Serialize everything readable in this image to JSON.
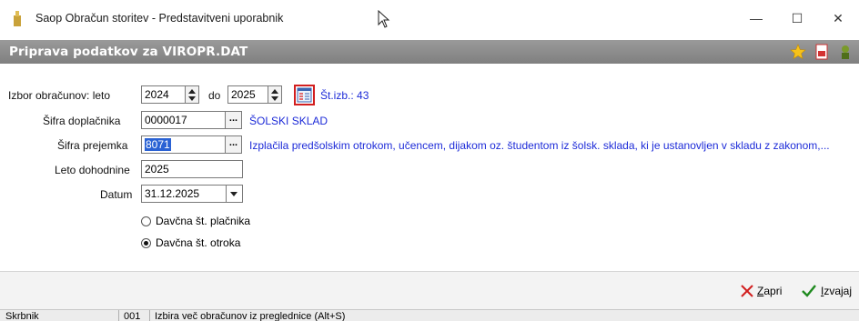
{
  "window": {
    "title": "Saop Obračun storitev - Predstavitveni uporabnik",
    "minimize_label": "—",
    "maximize_label": "☐",
    "close_label": "✕"
  },
  "header": {
    "title": "Priprava podatkov za VIROPR.DAT"
  },
  "form": {
    "obracun_label": "Izbor obračunov: leto",
    "leto_from": "2024",
    "do_label": "do",
    "leto_to": "2025",
    "st_izb": "Št.izb.: 43",
    "doplacnik_label": "Šifra doplačnika",
    "doplacnik_value": "0000017",
    "doplacnik_name": "ŠOLSKI SKLAD",
    "prejemka_label": "Šifra prejemka",
    "prejemka_value": "8071",
    "prejemka_desc": "Izplačila predšolskim otrokom, učencem, dijakom oz. študentom iz šolsk. sklada, ki je ustanovljen v skladu z zakonom,...",
    "dohodnine_label": "Leto dohodnine",
    "dohodnine_value": "2025",
    "datum_label": "Datum",
    "datum_value": "31.12.2025",
    "radio_placnik": "Davčna št. plačnika",
    "radio_otroka": "Davčna št. otroka",
    "dots_label": "...",
    "selected_radio": "otroka"
  },
  "buttons": {
    "zapri_prefix": "Z",
    "zapri_rest": "apri",
    "izvajaj_prefix": "I",
    "izvajaj_rest": "zvajaj"
  },
  "statusbar": {
    "user": "Skrbnik",
    "code": "001",
    "hint": "Izbira več obračunov iz preglednice (Alt+S)"
  },
  "colors": {
    "link": "#1d2bd8",
    "header_bg": "#8c8c8c",
    "highlight_border": "#d21f1f",
    "close_x": "#d21f1f",
    "check": "#1f8a1f"
  }
}
